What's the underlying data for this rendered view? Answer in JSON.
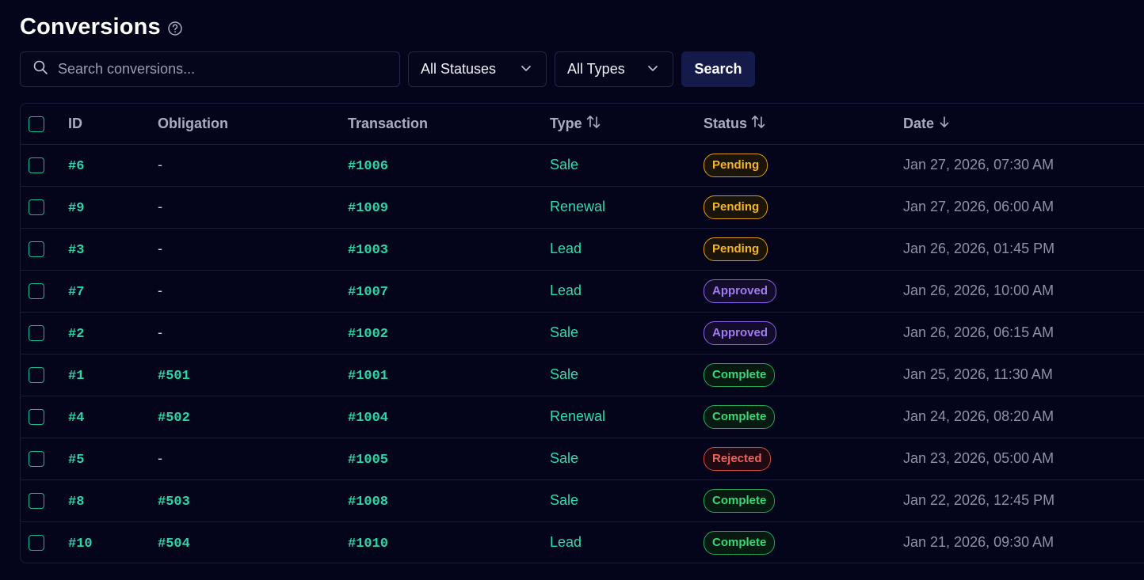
{
  "header": {
    "title": "Conversions",
    "help_icon": "question-circle-icon"
  },
  "toolbar": {
    "search_placeholder": "Search conversions...",
    "status_filter": "All Statuses",
    "type_filter": "All Types",
    "search_button": "Search"
  },
  "table": {
    "columns": {
      "id": "ID",
      "obligation": "Obligation",
      "transaction": "Transaction",
      "type": "Type",
      "status": "Status",
      "date": "Date"
    },
    "rows": [
      {
        "id": "#6",
        "obligation": "-",
        "transaction": "#1006",
        "type": "Sale",
        "status": "Pending",
        "status_key": "pending",
        "date": "Jan 27, 2026, 07:30 AM"
      },
      {
        "id": "#9",
        "obligation": "-",
        "transaction": "#1009",
        "type": "Renewal",
        "status": "Pending",
        "status_key": "pending",
        "date": "Jan 27, 2026, 06:00 AM"
      },
      {
        "id": "#3",
        "obligation": "-",
        "transaction": "#1003",
        "type": "Lead",
        "status": "Pending",
        "status_key": "pending",
        "date": "Jan 26, 2026, 01:45 PM"
      },
      {
        "id": "#7",
        "obligation": "-",
        "transaction": "#1007",
        "type": "Lead",
        "status": "Approved",
        "status_key": "approved",
        "date": "Jan 26, 2026, 10:00 AM"
      },
      {
        "id": "#2",
        "obligation": "-",
        "transaction": "#1002",
        "type": "Sale",
        "status": "Approved",
        "status_key": "approved",
        "date": "Jan 26, 2026, 06:15 AM"
      },
      {
        "id": "#1",
        "obligation": "#501",
        "transaction": "#1001",
        "type": "Sale",
        "status": "Complete",
        "status_key": "complete",
        "date": "Jan 25, 2026, 11:30 AM"
      },
      {
        "id": "#4",
        "obligation": "#502",
        "transaction": "#1004",
        "type": "Renewal",
        "status": "Complete",
        "status_key": "complete",
        "date": "Jan 24, 2026, 08:20 AM"
      },
      {
        "id": "#5",
        "obligation": "-",
        "transaction": "#1005",
        "type": "Sale",
        "status": "Rejected",
        "status_key": "rejected",
        "date": "Jan 23, 2026, 05:00 AM"
      },
      {
        "id": "#8",
        "obligation": "#503",
        "transaction": "#1008",
        "type": "Sale",
        "status": "Complete",
        "status_key": "complete",
        "date": "Jan 22, 2026, 12:45 PM"
      },
      {
        "id": "#10",
        "obligation": "#504",
        "transaction": "#1010",
        "type": "Lead",
        "status": "Complete",
        "status_key": "complete",
        "date": "Jan 21, 2026, 09:30 AM"
      }
    ]
  },
  "colors": {
    "background": "#04041a",
    "accent": "#2dd4a8",
    "pending": "#f5b623",
    "approved": "#a07cf0",
    "complete": "#36d877",
    "rejected": "#f0625e"
  }
}
